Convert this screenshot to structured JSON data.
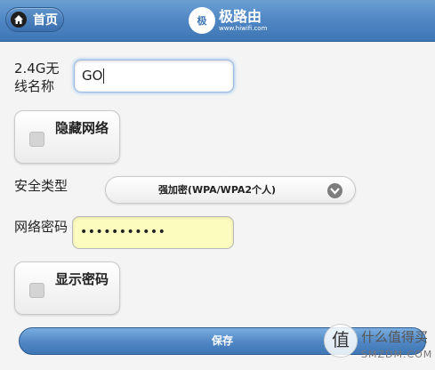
{
  "header": {
    "home_label": "首页",
    "logo_mark": "极",
    "logo_name": "极路由",
    "logo_url": "www.hiwifi.com"
  },
  "form": {
    "ssid_label": "2.4G无线名称",
    "ssid_value": "GO",
    "hide_ssid_label": "隐藏网络",
    "security_label": "安全类型",
    "security_value": "强加密(WPA/WPA2个人)",
    "password_label": "网络密码",
    "password_value": "•••••••••••",
    "show_password_label": "显示密码",
    "save_label": "保存"
  },
  "watermark": {
    "mark": "值",
    "text": "什么值得买",
    "sub": "SMZDM.COM"
  }
}
